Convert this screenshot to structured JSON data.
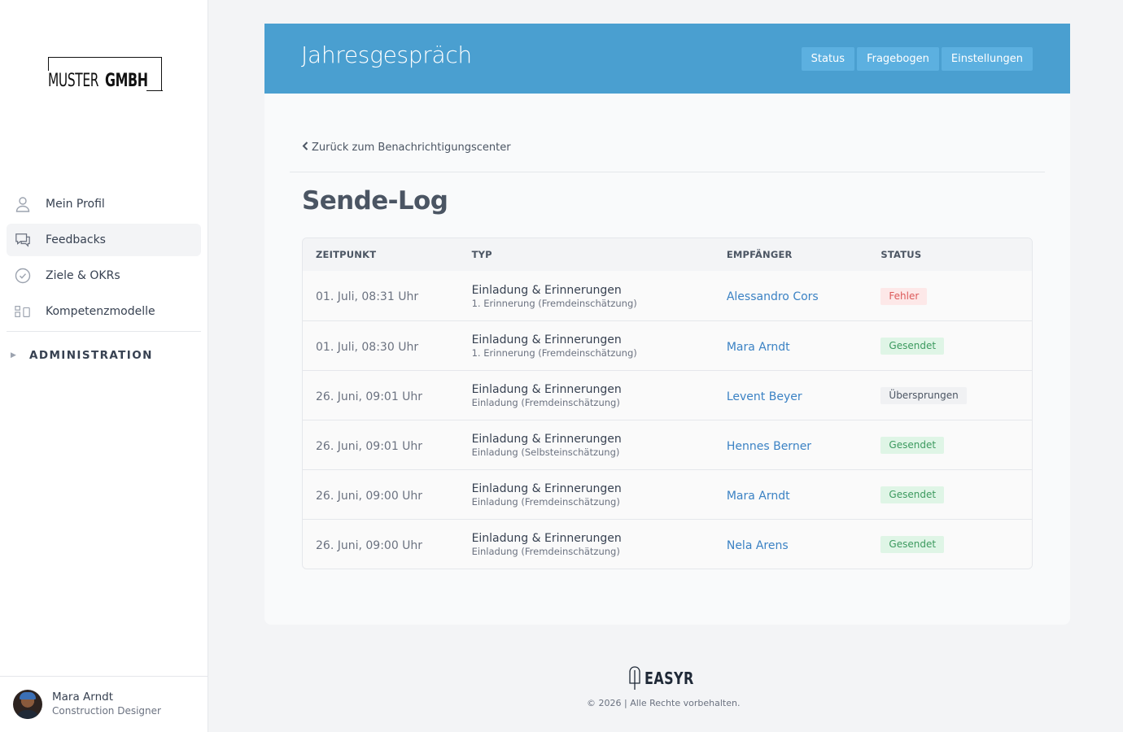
{
  "company_logo": {
    "part_light": "MUSTER",
    "part_bold": "GMBH"
  },
  "sidebar": {
    "items": [
      {
        "label": "Mein Profil",
        "icon": "user-icon"
      },
      {
        "label": "Feedbacks",
        "icon": "chat-icon",
        "active": true
      },
      {
        "label": "Ziele & OKRs",
        "icon": "check-circle-icon"
      },
      {
        "label": "Kompetenzmodelle",
        "icon": "model-icon"
      }
    ],
    "admin_label": "ADMINISTRATION"
  },
  "user": {
    "name": "Mara Arndt",
    "role": "Construction Designer"
  },
  "header": {
    "title": "Jahresgespräch",
    "tabs": [
      "Status",
      "Fragebogen",
      "Einstellungen"
    ]
  },
  "back_link": "Zurück zum Benachrichtigungscenter",
  "page_title": "Sende-Log",
  "table": {
    "headers": [
      "ZEITPUNKT",
      "TYP",
      "EMPFÄNGER",
      "STATUS"
    ],
    "rows": [
      {
        "time": "01. Juli, 08:31 Uhr",
        "type": "Einladung & Erinnerungen",
        "subtype": "1. Erinnerung (Fremdeinschätzung)",
        "recipient": "Alessandro Cors",
        "status": "Fehler",
        "status_kind": "error"
      },
      {
        "time": "01. Juli, 08:30 Uhr",
        "type": "Einladung & Erinnerungen",
        "subtype": "1. Erinnerung (Fremdeinschätzung)",
        "recipient": "Mara Arndt",
        "status": "Gesendet",
        "status_kind": "sent"
      },
      {
        "time": "26. Juni, 09:01 Uhr",
        "type": "Einladung & Erinnerungen",
        "subtype": "Einladung (Fremdeinschätzung)",
        "recipient": "Levent Beyer",
        "status": "Übersprungen",
        "status_kind": "skipped"
      },
      {
        "time": "26. Juni, 09:01 Uhr",
        "type": "Einladung & Erinnerungen",
        "subtype": "Einladung (Selbsteinschätzung)",
        "recipient": "Hennes Berner",
        "status": "Gesendet",
        "status_kind": "sent"
      },
      {
        "time": "26. Juni, 09:00 Uhr",
        "type": "Einladung & Erinnerungen",
        "subtype": "Einladung (Fremdeinschätzung)",
        "recipient": "Mara Arndt",
        "status": "Gesendet",
        "status_kind": "sent"
      },
      {
        "time": "26. Juni, 09:00 Uhr",
        "type": "Einladung & Erinnerungen",
        "subtype": "Einladung (Fremdeinschätzung)",
        "recipient": "Nela Arens",
        "status": "Gesendet",
        "status_kind": "sent"
      }
    ]
  },
  "footer": {
    "brand": "EASYR",
    "copyright": "© 2026 | Alle Rechte vorbehalten."
  },
  "colors": {
    "accent": "#4a9fd0",
    "link": "#3b82c4",
    "error": "#dc5a5a",
    "success": "#3c9a5f"
  }
}
